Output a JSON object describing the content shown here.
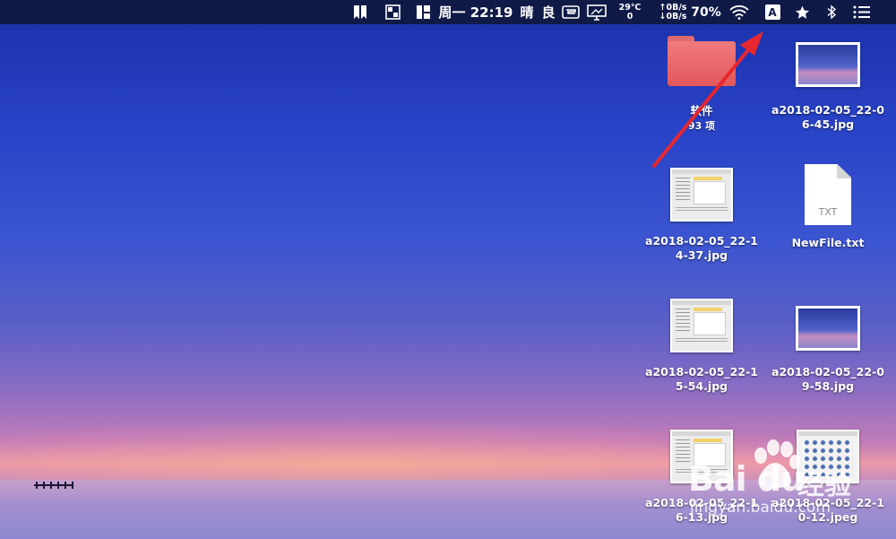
{
  "menubar": {
    "weekday": "周一",
    "time": "22:19",
    "weather": "晴",
    "air_quality": "良",
    "temperature": "29℃",
    "temperature_sub": "0",
    "net_up": "↑0B/s",
    "net_down": "↓0B/s",
    "battery": "70%",
    "input_method": "A"
  },
  "desktop": {
    "items": [
      {
        "label": "软件",
        "sub": "93 项",
        "kind": "folder"
      },
      {
        "label": "a2018-02-05_22-06-45.jpg",
        "kind": "photo"
      },
      {
        "label": "a2018-02-05_22-14-37.jpg",
        "kind": "screenshot"
      },
      {
        "label": "NewFile.txt",
        "kind": "txt",
        "badge": "TXT"
      },
      {
        "label": "a2018-02-05_22-15-54.jpg",
        "kind": "screenshot"
      },
      {
        "label": "a2018-02-05_22-09-58.jpg",
        "kind": "photo"
      },
      {
        "label": "a2018-02-05_22-16-13.jpg",
        "kind": "screenshot"
      },
      {
        "label": "a2018-02-05_22-10-12.jpeg",
        "kind": "screenshot-grid"
      }
    ]
  },
  "watermark": {
    "brand": "Bai du",
    "cn": "经验",
    "url": "jingyan.baidu.com"
  },
  "colors": {
    "menubar": "#0f1a47",
    "folder": "#e8676b",
    "arrow": "#e8262e"
  }
}
